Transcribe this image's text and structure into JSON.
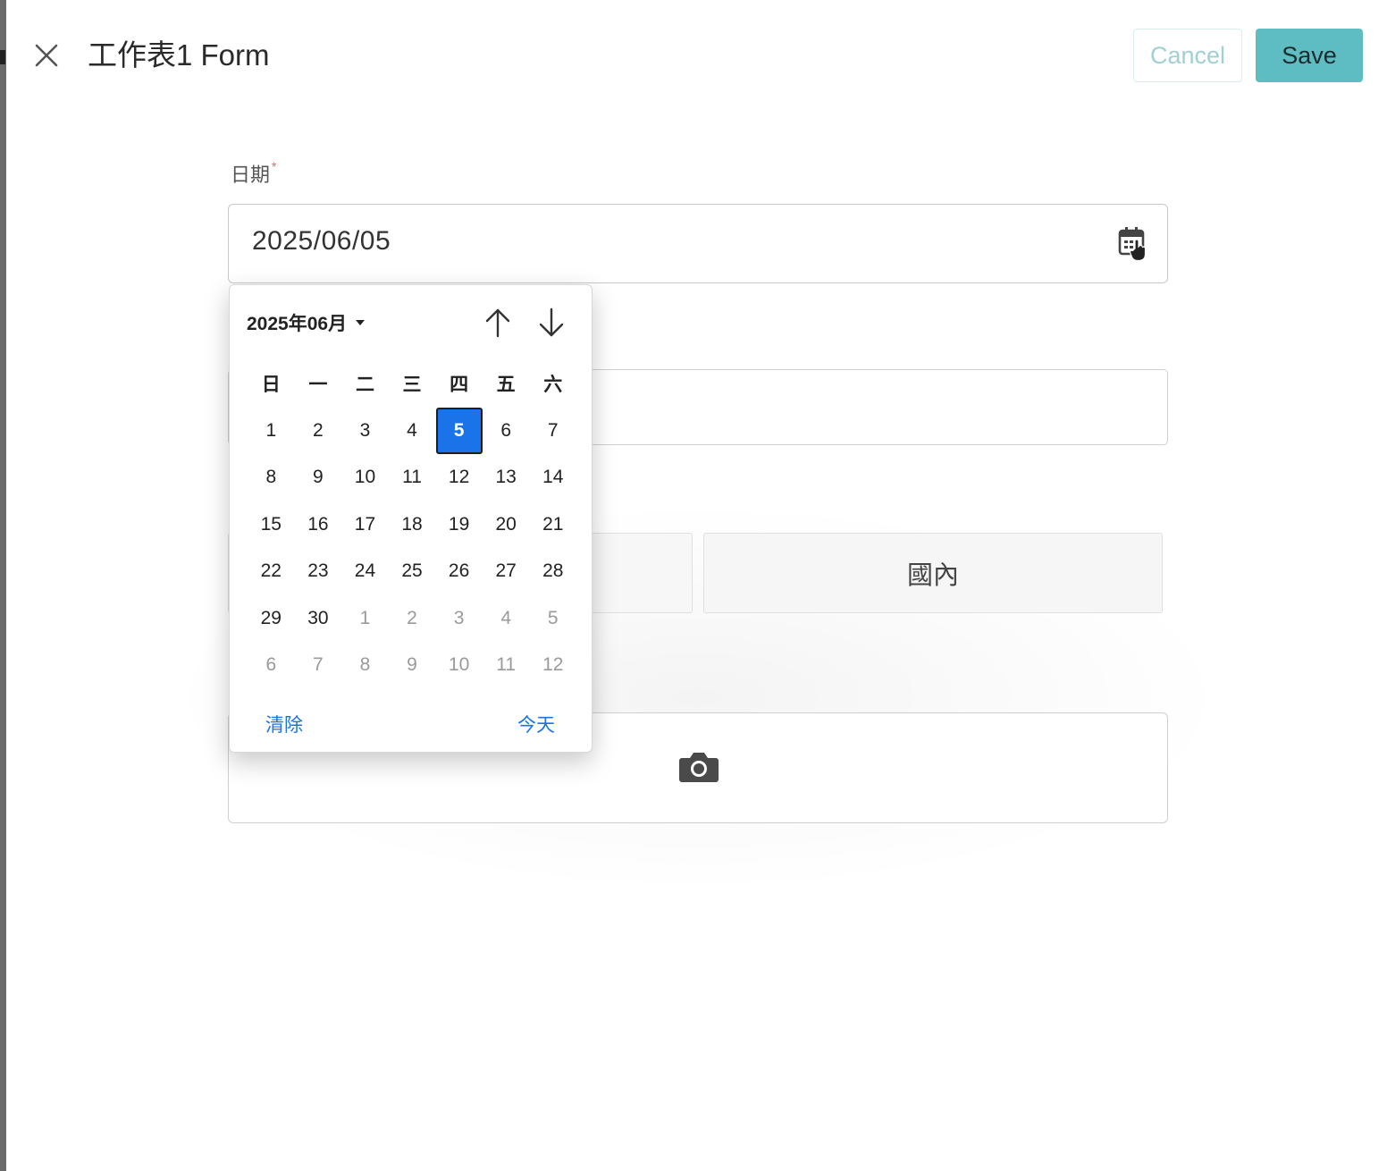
{
  "header": {
    "title": "工作表1 Form",
    "cancel_label": "Cancel",
    "save_label": "Save",
    "close_icon": "close-icon"
  },
  "form": {
    "date_label": "日期",
    "required_mark": "*",
    "date_value": "2025/06/05",
    "calendar_icon": "calendar-icon",
    "option_right": "國內",
    "camera_icon": "camera-icon"
  },
  "calendar": {
    "month_label": "2025年06月",
    "weekdays": [
      "日",
      "一",
      "二",
      "三",
      "四",
      "五",
      "六"
    ],
    "weeks": [
      [
        "1",
        "2",
        "3",
        "4",
        "5",
        "6",
        "7"
      ],
      [
        "8",
        "9",
        "10",
        "11",
        "12",
        "13",
        "14"
      ],
      [
        "15",
        "16",
        "17",
        "18",
        "19",
        "20",
        "21"
      ],
      [
        "22",
        "23",
        "24",
        "25",
        "26",
        "27",
        "28"
      ],
      [
        "29",
        "30",
        "1",
        "2",
        "3",
        "4",
        "5"
      ],
      [
        "6",
        "7",
        "8",
        "9",
        "10",
        "11",
        "12"
      ]
    ],
    "selected_day": "5",
    "clear_label": "清除",
    "today_label": "今天"
  },
  "colors": {
    "accent": "#5ebdc2",
    "selected": "#1a73e8"
  }
}
